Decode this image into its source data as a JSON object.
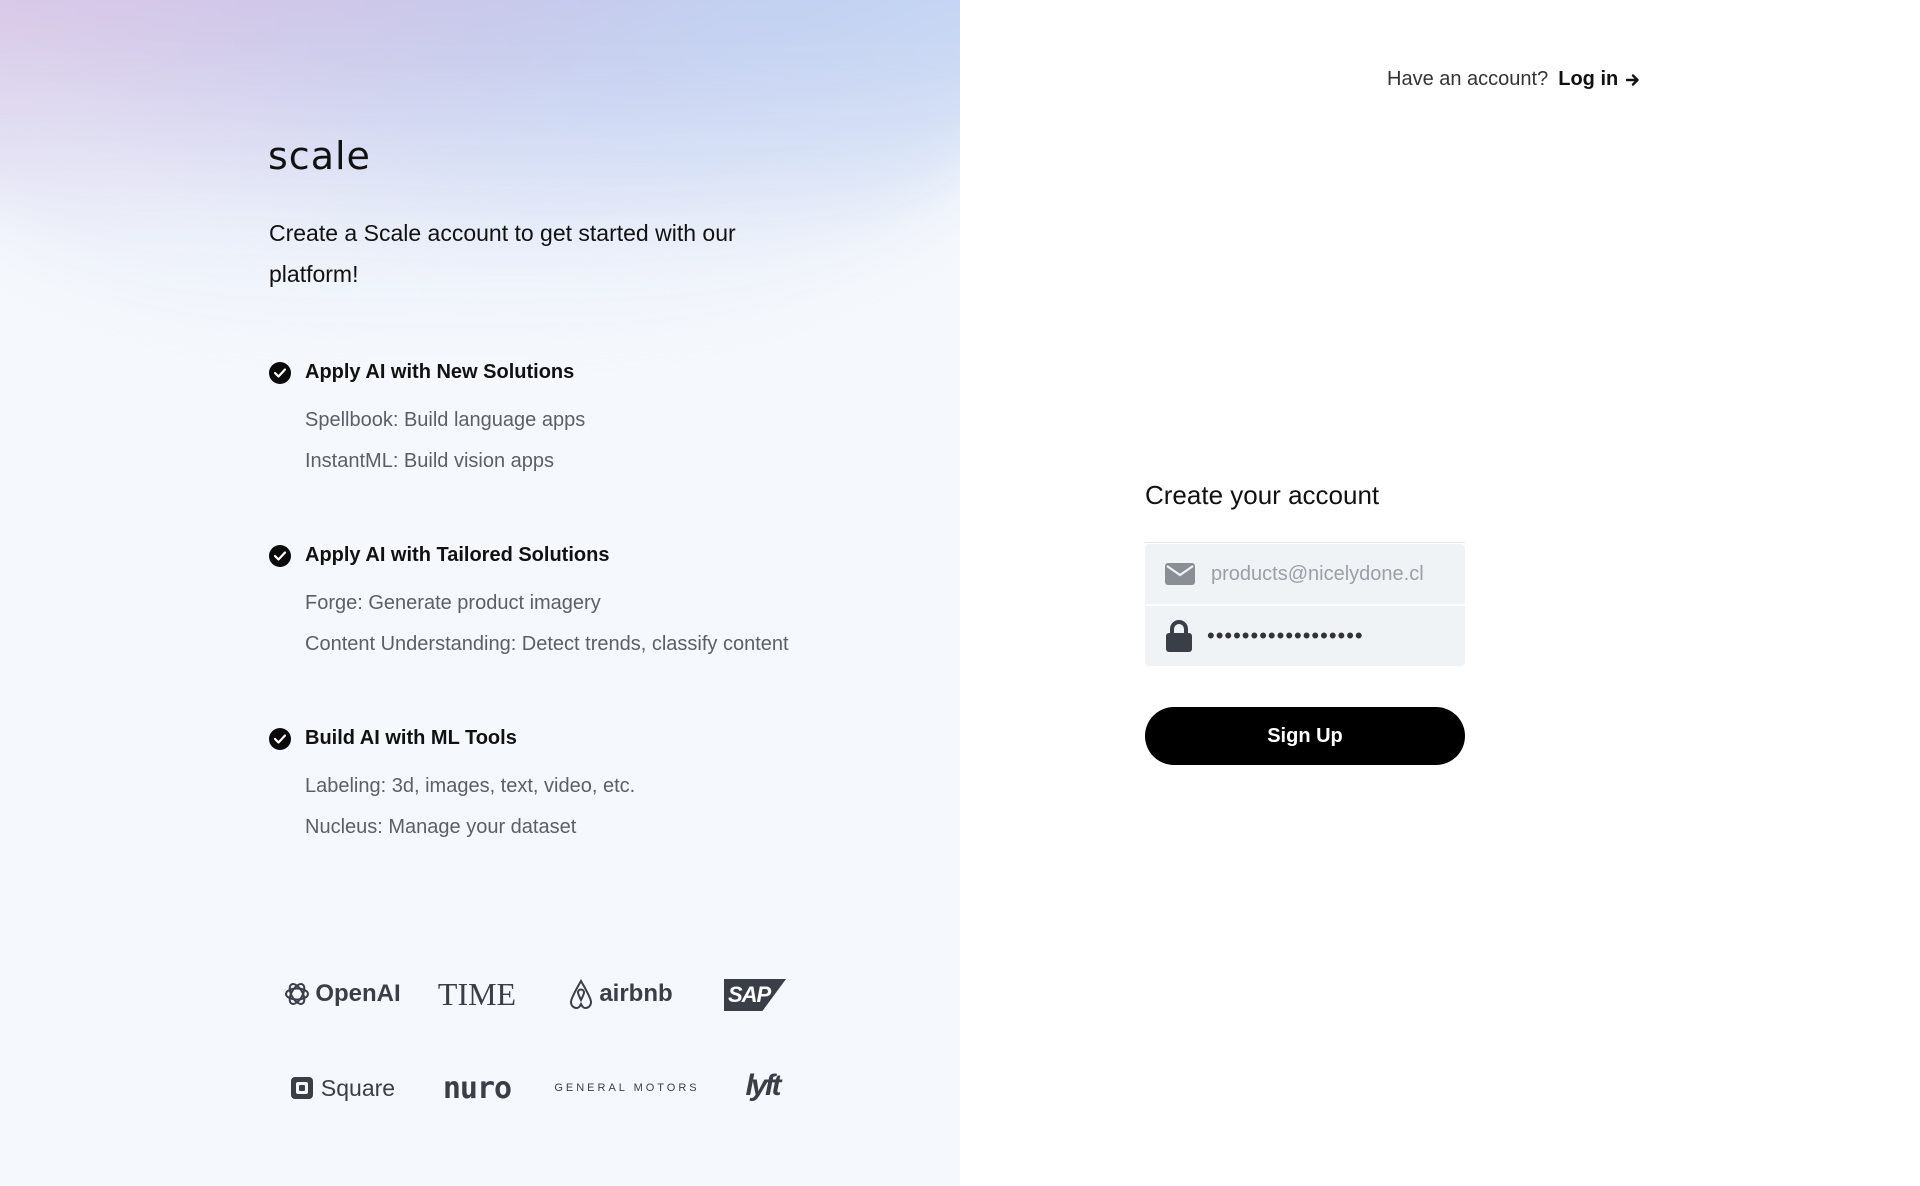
{
  "brand": {
    "logo": "scale"
  },
  "left": {
    "tagline": "Create a Scale account to get started with our platform!",
    "features": [
      {
        "title": "Apply AI with New Solutions",
        "items": [
          "Spellbook: Build language apps",
          "InstantML: Build vision apps"
        ]
      },
      {
        "title": "Apply AI with Tailored Solutions",
        "items": [
          "Forge: Generate product imagery",
          "Content Understanding: Detect trends, classify content"
        ]
      },
      {
        "title": "Build AI with ML Tools",
        "items": [
          "Labeling: 3d, images, text, video, etc.",
          "Nucleus: Manage your dataset"
        ]
      }
    ],
    "customer_logos": [
      "OpenAI",
      "TIME",
      "airbnb",
      "SAP",
      "Square",
      "nuro",
      "GENERAL MOTORS",
      "lyft"
    ]
  },
  "header": {
    "have_account": "Have an account?",
    "login_label": "Log in"
  },
  "form": {
    "title": "Create your account",
    "email_placeholder": "products@nicelydone.cl",
    "password_mask": "••••••••••••••••••",
    "signup_label": "Sign Up"
  },
  "colors": {
    "primary_button": "#000000",
    "field_bg": "#f0f3f6",
    "muted_text": "#5c5f66"
  }
}
